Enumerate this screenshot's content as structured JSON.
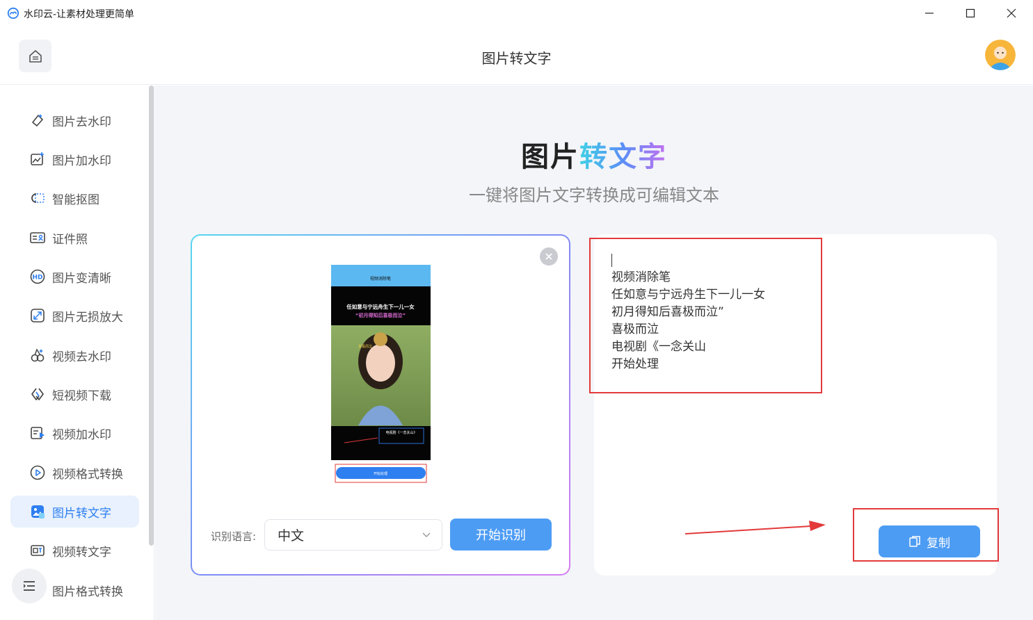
{
  "window": {
    "title": "水印云-让素材处理更简单",
    "app_icon": "cloud-icon"
  },
  "header": {
    "title": "图片转文字",
    "home_icon": "home-icon"
  },
  "sidebar": {
    "items": [
      {
        "label": "图片去水印",
        "icon": "eraser-icon"
      },
      {
        "label": "图片加水印",
        "icon": "image-add-icon"
      },
      {
        "label": "智能抠图",
        "icon": "cutout-icon"
      },
      {
        "label": "证件照",
        "icon": "id-card-icon"
      },
      {
        "label": "图片变清晰",
        "icon": "hd-icon"
      },
      {
        "label": "图片无损放大",
        "icon": "enlarge-icon"
      },
      {
        "label": "视频去水印",
        "icon": "video-eraser-icon"
      },
      {
        "label": "短视频下载",
        "icon": "link-icon"
      },
      {
        "label": "视频加水印",
        "icon": "video-add-icon"
      },
      {
        "label": "视频格式转换",
        "icon": "play-circle-icon"
      },
      {
        "label": "图片转文字",
        "icon": "image-text-icon",
        "active": true
      },
      {
        "label": "视频转文字",
        "icon": "video-text-icon"
      },
      {
        "label": "图片格式转换",
        "icon": "format-icon"
      }
    ]
  },
  "main": {
    "title_plain": "图片",
    "title_gradient": "转文字",
    "subtitle": "一键将图片文字转换成可编辑文本",
    "preview": {
      "phone_header": "视频消除笔",
      "caption_line1": "任如意与宁远舟生下一儿一女",
      "caption_line2": "“初月得知后喜极而泣”",
      "overlay_text": "喜极而泣",
      "drama_label": "电视剧《一念关山》",
      "process_button": "开始处理"
    },
    "language_label": "识别语言:",
    "language_value": "中文",
    "start_button": "开始识别",
    "result_lines": [
      "视频消除笔",
      "任如意与宁远舟生下一儿一女",
      "初月得知后喜极而泣”",
      "喜极而泣",
      "电视剧《一念关山",
      "开始处理"
    ],
    "copy_button": "复制"
  },
  "colors": {
    "accent": "#4d9cf4",
    "active_bg": "#e8f1fd",
    "annotation_red": "#e33a3a",
    "gradient": [
      "#3fd0e6",
      "#5b8ef6",
      "#c46ff0"
    ]
  }
}
